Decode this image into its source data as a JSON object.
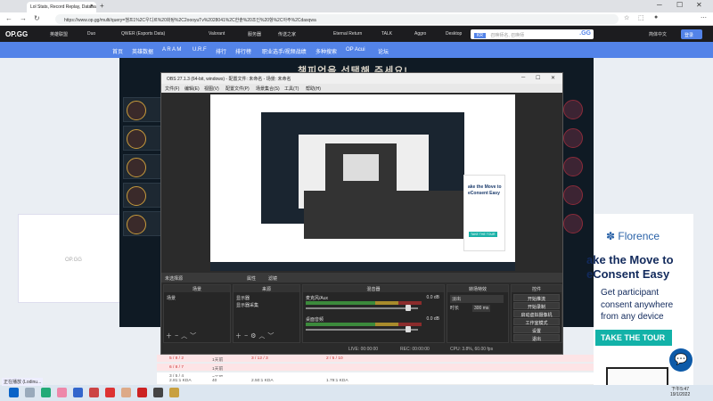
{
  "browser": {
    "tab_title": "Lol Stats, Record Replay, Databa",
    "url": "https://www.op.gg/multi/query=챔프1%2C우디르%20화탕%2C2oooyuTv%2028041%2C한솥%20조인%20항%2C아주%2Cdasqwa",
    "icons": [
      "back-icon",
      "forward-icon",
      "refresh-icon",
      "star-icon",
      "extensions-icon",
      "profile-icon",
      "menu-icon"
    ]
  },
  "opgg": {
    "logo": "OP.GG",
    "nav_items": [
      "英雄联盟",
      "Duo",
      "QWER (Esports Data)",
      "Valorant",
      "服务器",
      "传送之家",
      "Eternal Return",
      "TALK",
      "Aggro",
      "Desktop"
    ],
    "search_region": "KR",
    "search_placeholder": "召唤师名, 召唤师",
    "search_go": ".GG",
    "lang": "简体中文",
    "login": "登录",
    "sub_nav": [
      "首页",
      "英雄数据",
      "A R A M",
      "U.R.F",
      "排行",
      "排行榜",
      "职业选手/视频战绩",
      "多种搜索",
      "OP Acui",
      "论坛"
    ]
  },
  "champ_select": {
    "title": "챔피언을 선택해 주세요!",
    "left_box_label": "OP.GG",
    "pick_names": [
      "",
      "",
      "",
      "",
      ""
    ]
  },
  "obs": {
    "title": "OBS 27.1.3 (64-bit, windows) - 配置文件: 未命名 - 场景: 未命名",
    "menu": [
      "文件(F)",
      "编辑(E)",
      "视图(V)",
      "配置文件(P)",
      "场景集合(S)",
      "工具(T)",
      "帮助(H)"
    ],
    "scene_bar_label": "未选择源",
    "scene_bar_props": "属性",
    "scene_bar_filters": "滤镜",
    "docks": {
      "scenes": {
        "title": "场景",
        "items": [
          "场景"
        ]
      },
      "sources": {
        "title": "来源",
        "items": [
          "显示器",
          "显示器采集"
        ]
      },
      "mixer": {
        "title": "混音器",
        "channels": [
          {
            "name": "桌面音频",
            "db": "0.0 dB"
          },
          {
            "name": "麦克风/Aux",
            "db": "0.0 dB"
          }
        ]
      },
      "transitions": {
        "title": "转场特效",
        "type": "淡出",
        "duration_label": "时长",
        "duration": "300 ms"
      },
      "controls": {
        "title": "控件",
        "buttons": [
          "开始推流",
          "开始录制",
          "启动虚拟摄像机",
          "工作室模式",
          "设置",
          "退出"
        ]
      }
    },
    "status": {
      "live": "LIVE: 00:00:00",
      "rec": "REC: 00:00:00",
      "cpu": "CPU: 3.8%, 60.00 fps"
    }
  },
  "ad": {
    "logo": "Florence",
    "headline_1": "ake the Move to",
    "headline_2": "eConsent Easy",
    "sub_1": "Get participant",
    "sub_2": "consent anywhere",
    "sub_3": "from any device",
    "cta": "TAKE THE TOUR",
    "colors": {
      "brand": "#12b2a8",
      "navy": "#122a5c"
    }
  },
  "table": {
    "rows": [
      {
        "kda": "5 / 8 / 2",
        "games": "1天前",
        "score": "3 / 12 / 3",
        "s2": "2 / 5 / 10",
        "red": true
      },
      {
        "kda": "6 / 8 / 7",
        "games": "1天前",
        "score": "",
        "s2": "",
        "red": true
      },
      {
        "kda": "3 / 5 / 4",
        "games": "3天前",
        "score": "",
        "s2": "",
        "red": false
      },
      {
        "kda": "2.81:1 KDA",
        "games": "40",
        "score": "2.50:1 KDA",
        "s2": "1.79:1 KDA",
        "red": false
      }
    ]
  },
  "taskbar": {
    "tooltip": "正在播放 (Lodinu...",
    "time": "下午5:47",
    "date": "19/1/2022"
  }
}
